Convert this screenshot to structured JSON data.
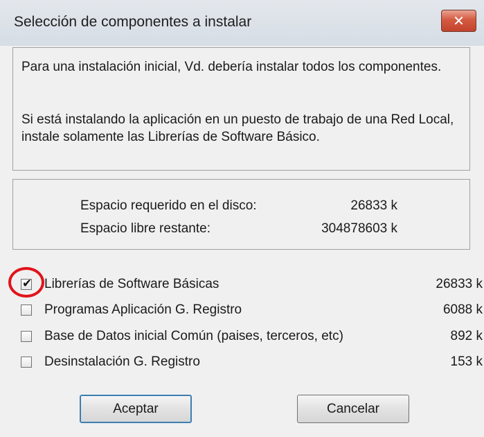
{
  "window": {
    "title": "Selección de componentes a instalar",
    "close_glyph": "✕"
  },
  "info": {
    "paragraph1": "Para una instalación inicial, Vd. debería instalar todos los componentes.",
    "paragraph2": "Si está instalando la aplicación en un puesto de trabajo de una Red Local, instale solamente las Librerías de Software Básico."
  },
  "disk": {
    "required_label": "Espacio requerido en el disco:",
    "required_value": "26833 k",
    "free_label": "Espacio libre restante:",
    "free_value": "304878603 k"
  },
  "components": [
    {
      "label": "Librerías de Software Básicas",
      "size": "26833 k",
      "checked": true
    },
    {
      "label": "Programas Aplicación G. Registro",
      "size": "6088 k",
      "checked": false
    },
    {
      "label": "Base de Datos inicial Común (paises, terceros, etc)",
      "size": "892 k",
      "checked": false
    },
    {
      "label": "Desinstalación G. Registro",
      "size": "153 k",
      "checked": false
    }
  ],
  "buttons": {
    "accept_label": "Aceptar",
    "cancel_label": "Cancelar"
  },
  "icons": {
    "close": "close-icon",
    "check": "checkmark-icon"
  },
  "colors": {
    "close_button": "#c94a33",
    "highlight_ring": "#e0141b",
    "default_button_border": "#3c7fb1"
  }
}
